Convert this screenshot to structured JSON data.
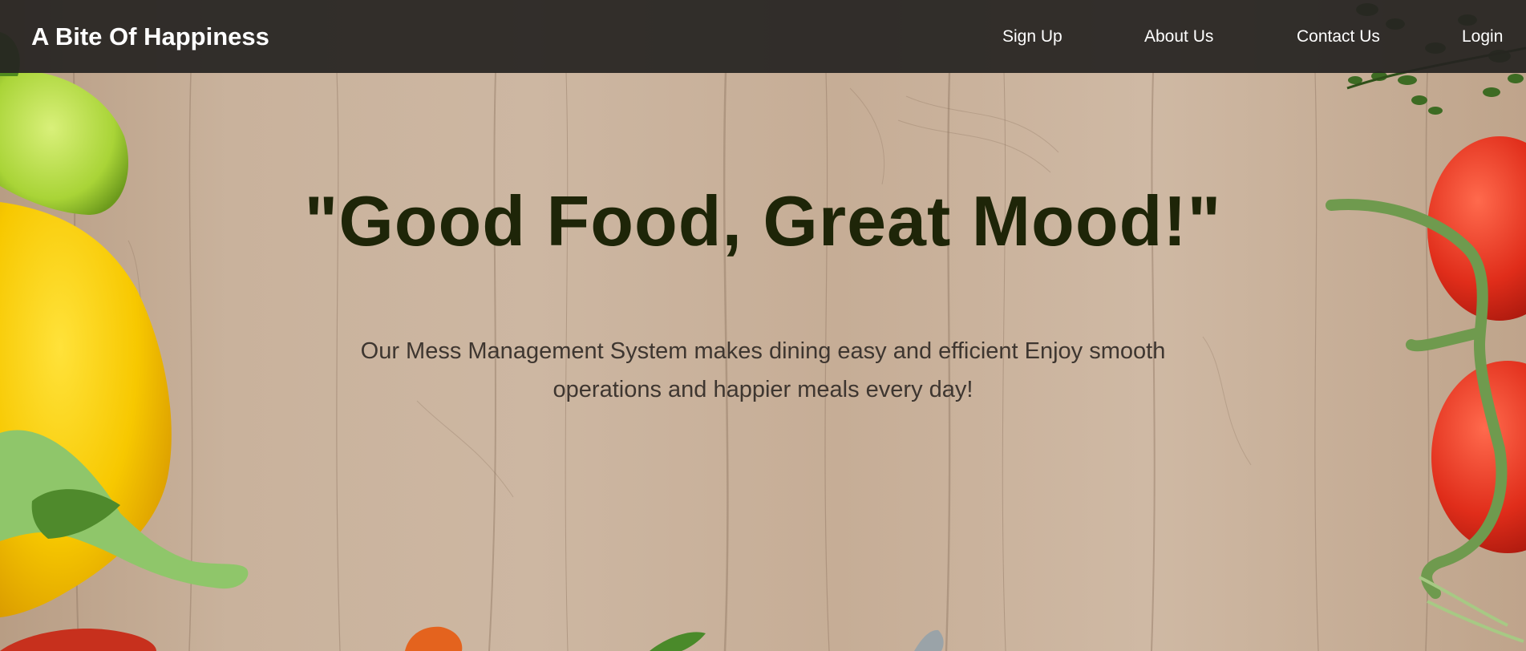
{
  "navbar": {
    "brand": "A Bite Of Happiness",
    "links": [
      {
        "label": "Sign Up"
      },
      {
        "label": "About Us"
      },
      {
        "label": "Contact Us"
      },
      {
        "label": "Login"
      }
    ]
  },
  "hero": {
    "title": "\"Good Food, Great Mood!\"",
    "subtitle": "Our Mess Management System makes dining easy and efficient Enjoy smooth operations and happier meals every day!"
  },
  "colors": {
    "navbar_bg": "#262321",
    "title_text": "#1e2508",
    "subtitle_text": "#3e3630",
    "wood": "#c8b19b"
  }
}
